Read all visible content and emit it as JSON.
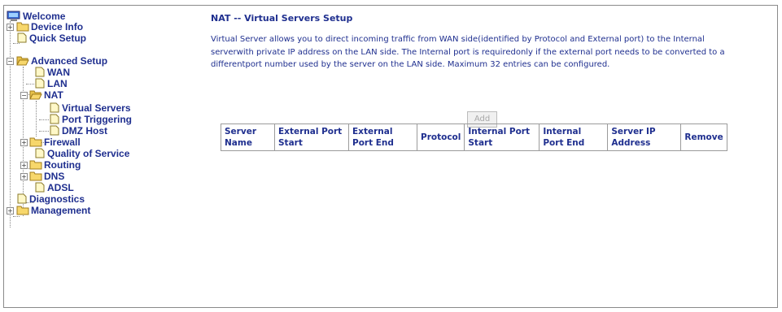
{
  "nav": {
    "welcome": "Welcome",
    "device_info": "Device Info",
    "quick_setup": "Quick Setup",
    "advanced_setup": "Advanced Setup",
    "wan": "WAN",
    "lan": "LAN",
    "nat": "NAT",
    "virtual_servers": "Virtual Servers",
    "port_triggering": "Port Triggering",
    "dmz_host": "DMZ Host",
    "firewall": "Firewall",
    "qos": "Quality of Service",
    "routing": "Routing",
    "dns": "DNS",
    "adsl": "ADSL",
    "diagnostics": "Diagnostics",
    "management": "Management"
  },
  "main": {
    "title": "NAT -- Virtual Servers Setup",
    "description": "Virtual Server allows you to direct incoming traffic from WAN side(identified by Protocol and External port) to the Internal serverwith private IP address on the LAN side. The Internal port is requiredonly if the external port needs to be converted to a differentport number used by the server on the LAN side. Maximum 32 entries can be configured.",
    "add_label": "Add",
    "columns": [
      "Server Name",
      "External Port Start",
      "External Port End",
      "Protocol",
      "Internal Port Start",
      "Internal Port End",
      "Server IP Address",
      "Remove"
    ]
  },
  "colors": {
    "text": "#1f2f8f",
    "folder": "#f7d76b",
    "border": "#9b9b9b"
  }
}
